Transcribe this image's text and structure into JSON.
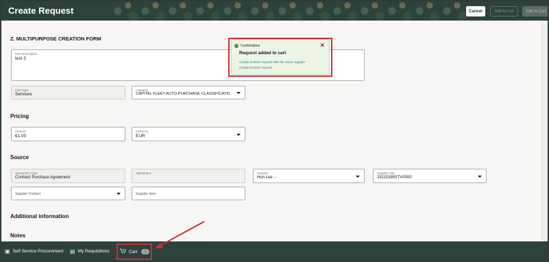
{
  "header": {
    "title": "Create Request",
    "cancel_label": "Cancel",
    "add_to_list_label": "Add to List",
    "add_to_cart_label": "Add to Cart"
  },
  "form": {
    "title": "Z. MULTIPURPOSE CREATION FORM",
    "item_description": {
      "label": "Item Description",
      "value": "test 3"
    },
    "line_type": {
      "label": "Line Type",
      "value": "Services"
    },
    "category": {
      "label": "Category",
      "value": "CAPITAL FLEET.AUTO.PURCHASE CLASSIFICATIC"
    }
  },
  "pricing": {
    "title": "Pricing",
    "amount": {
      "label": "Amount",
      "value": "€1.00"
    },
    "currency": {
      "label": "Currency",
      "value": "EUR"
    }
  },
  "source": {
    "title": "Source",
    "agreement_type": {
      "label": "Agreement Type",
      "value": "Contract Purchase Agreement"
    },
    "agreement": {
      "label": "Agreement",
      "value": ""
    },
    "supplier": {
      "label": "Supplier",
      "value": "Hun Lee ,-"
    },
    "supplier_site": {
      "label": "Supplier Site",
      "value": "291153855TV0000"
    },
    "supplier_contact": {
      "placeholder": "Supplier Contact"
    },
    "supplier_item": {
      "placeholder": "Supplier Item"
    }
  },
  "additional": {
    "title": "Additional information"
  },
  "notes": {
    "title": "Notes"
  },
  "confirmation": {
    "label": "Confirmation",
    "message": "Request added to cart",
    "link1": "Create another request with the same supplier",
    "link2": "Create another request"
  },
  "bottom_nav": {
    "self_service": "Self Service Procurement",
    "requisitions": "My Requisitions",
    "cart": "Cart",
    "cart_count": "1"
  },
  "colors": {
    "header_bg": "#2e423c",
    "highlight_red": "#d22c2c",
    "success_green": "#4f8b2c",
    "link_teal": "#22787e"
  }
}
